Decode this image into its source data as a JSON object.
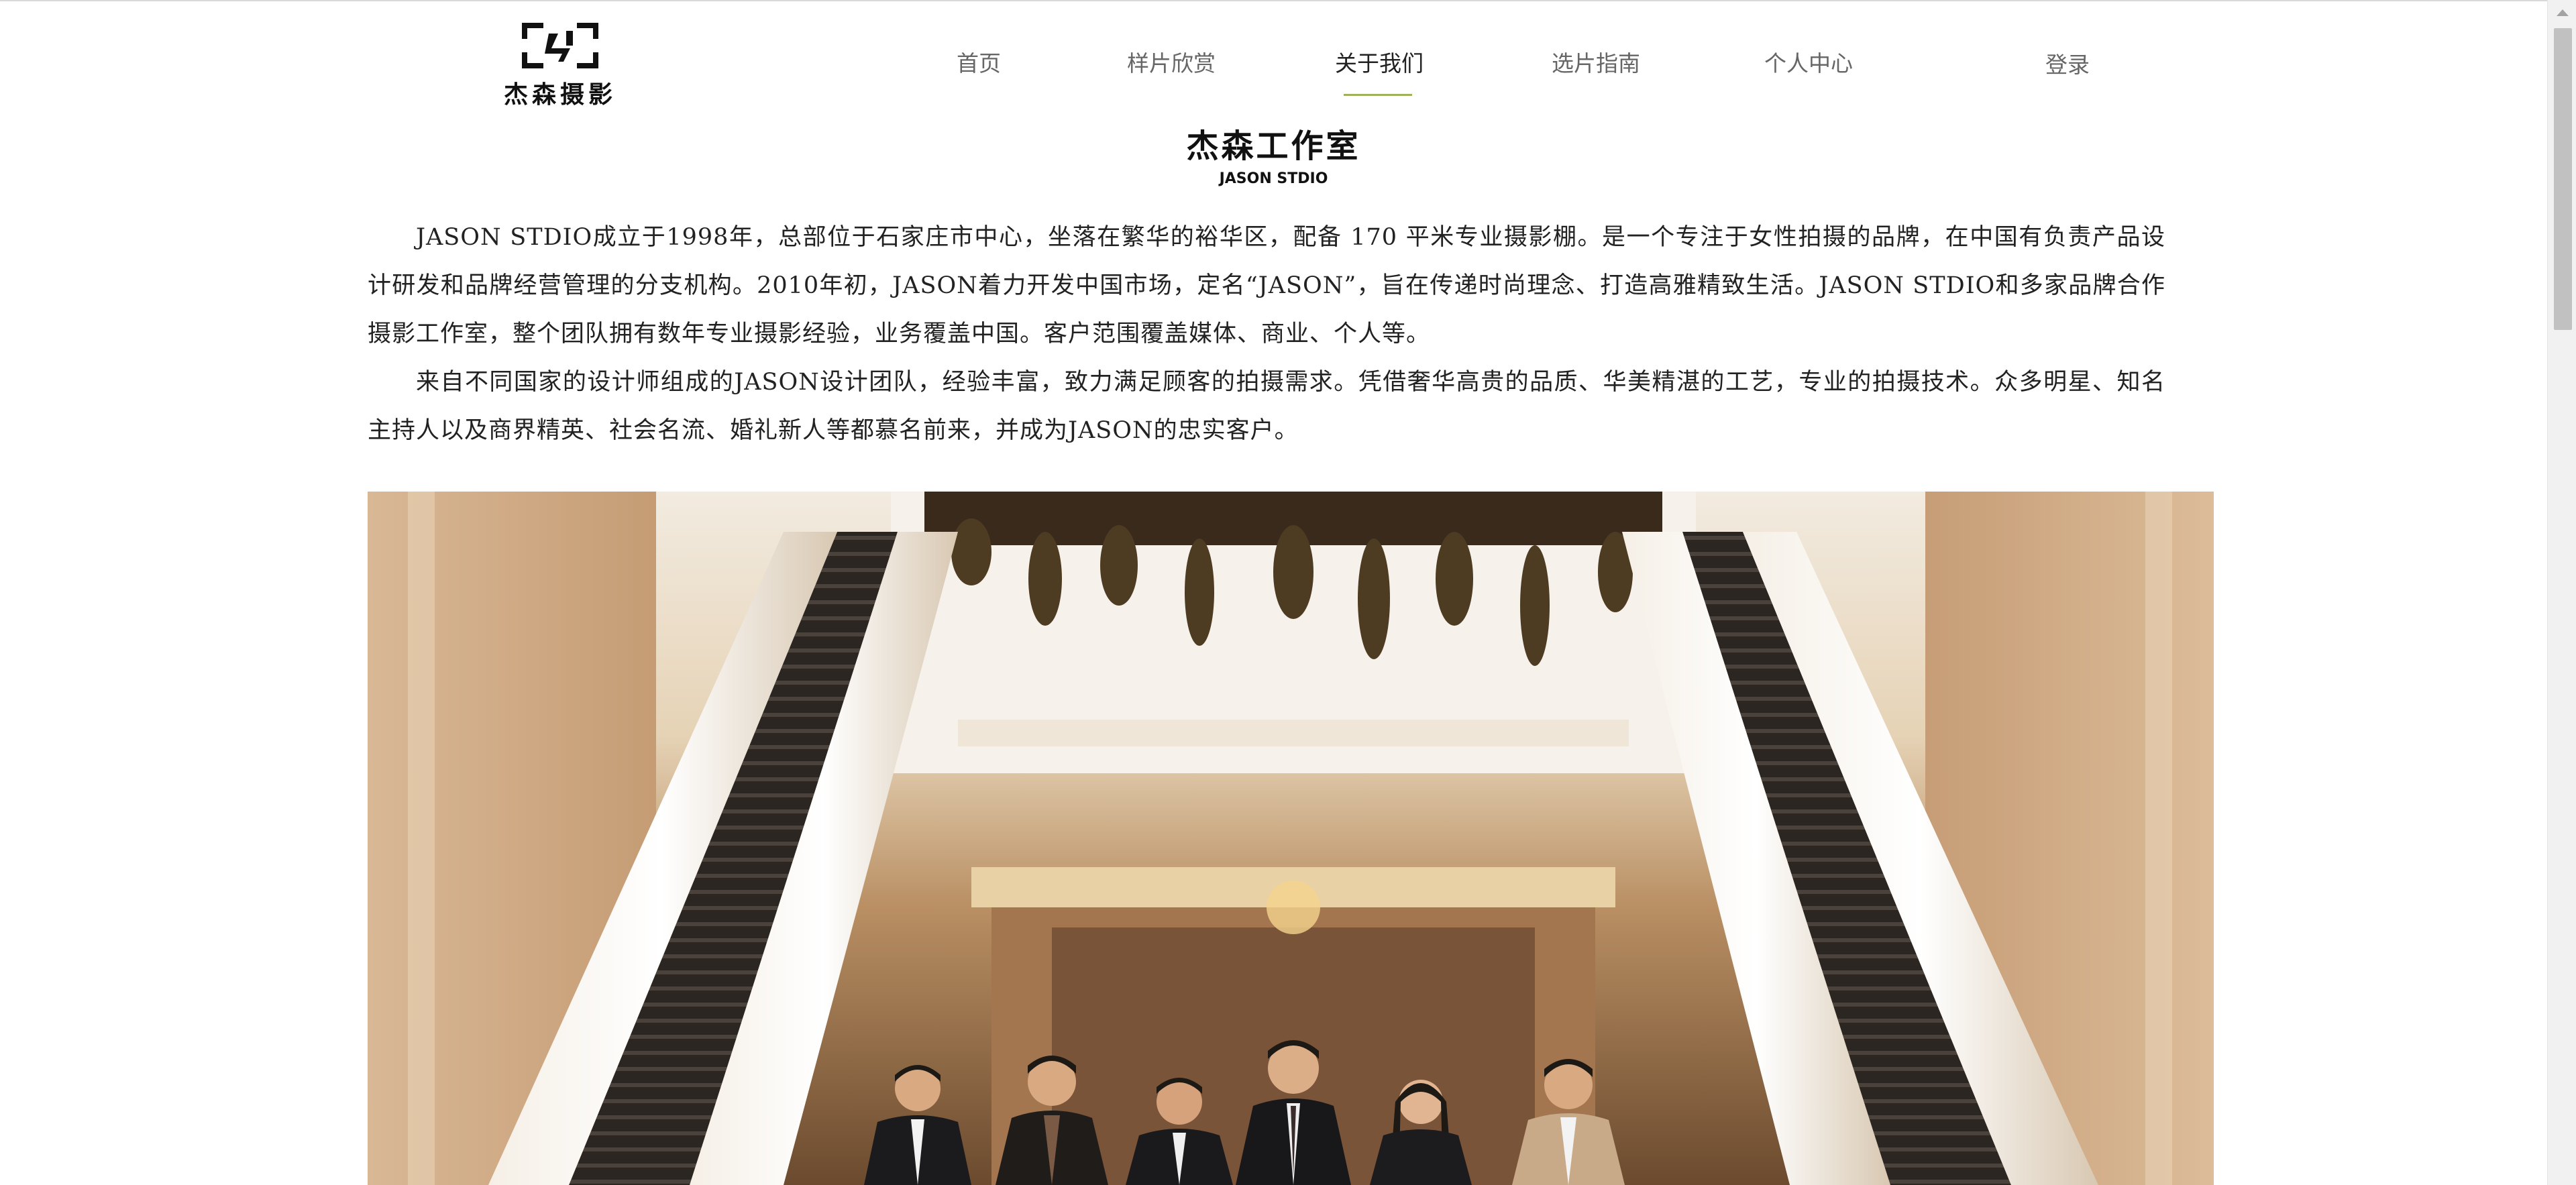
{
  "brand": {
    "name": "杰森摄影"
  },
  "nav": {
    "items": [
      {
        "label": "首页",
        "active": false
      },
      {
        "label": "样片欣赏",
        "active": false
      },
      {
        "label": "关于我们",
        "active": true
      },
      {
        "label": "选片指南",
        "active": false
      },
      {
        "label": "个人中心",
        "active": false
      }
    ],
    "login_label": "登录"
  },
  "about": {
    "title": "杰森工作室",
    "subtitle": "JASON STDIO",
    "paragraphs": [
      "JASON STDIO成立于1998年，总部位于石家庄市中心，坐落在繁华的裕华区，配备 170 平米专业摄影棚。是一个专注于女性拍摄的品牌，在中国有负责产品设计研发和品牌经营管理的分支机构。2010年初，JASON着力开发中国市场，定名“JASON”，旨在传递时尚理念、打造高雅精致生活。JASON STDIO和多家品牌合作摄影工作室，整个团队拥有数年专业摄影经验，业务覆盖中国。客户范围覆盖媒体、商业、个人等。",
      "来自不同国家的设计师组成的JASON设计团队，经验丰富，致力满足顾客的拍摄需求。凭借奢华高贵的品质、华美精湛的工艺，专业的拍摄技术。众多明星、知名主持人以及商界精英、社会名流、婚礼新人等都慕名前来，并成为JASON的忠实客户。"
    ]
  },
  "colors": {
    "nav_active_underline": "#9fb15a",
    "nav_text": "#666666",
    "nav_active_text": "#222222"
  }
}
